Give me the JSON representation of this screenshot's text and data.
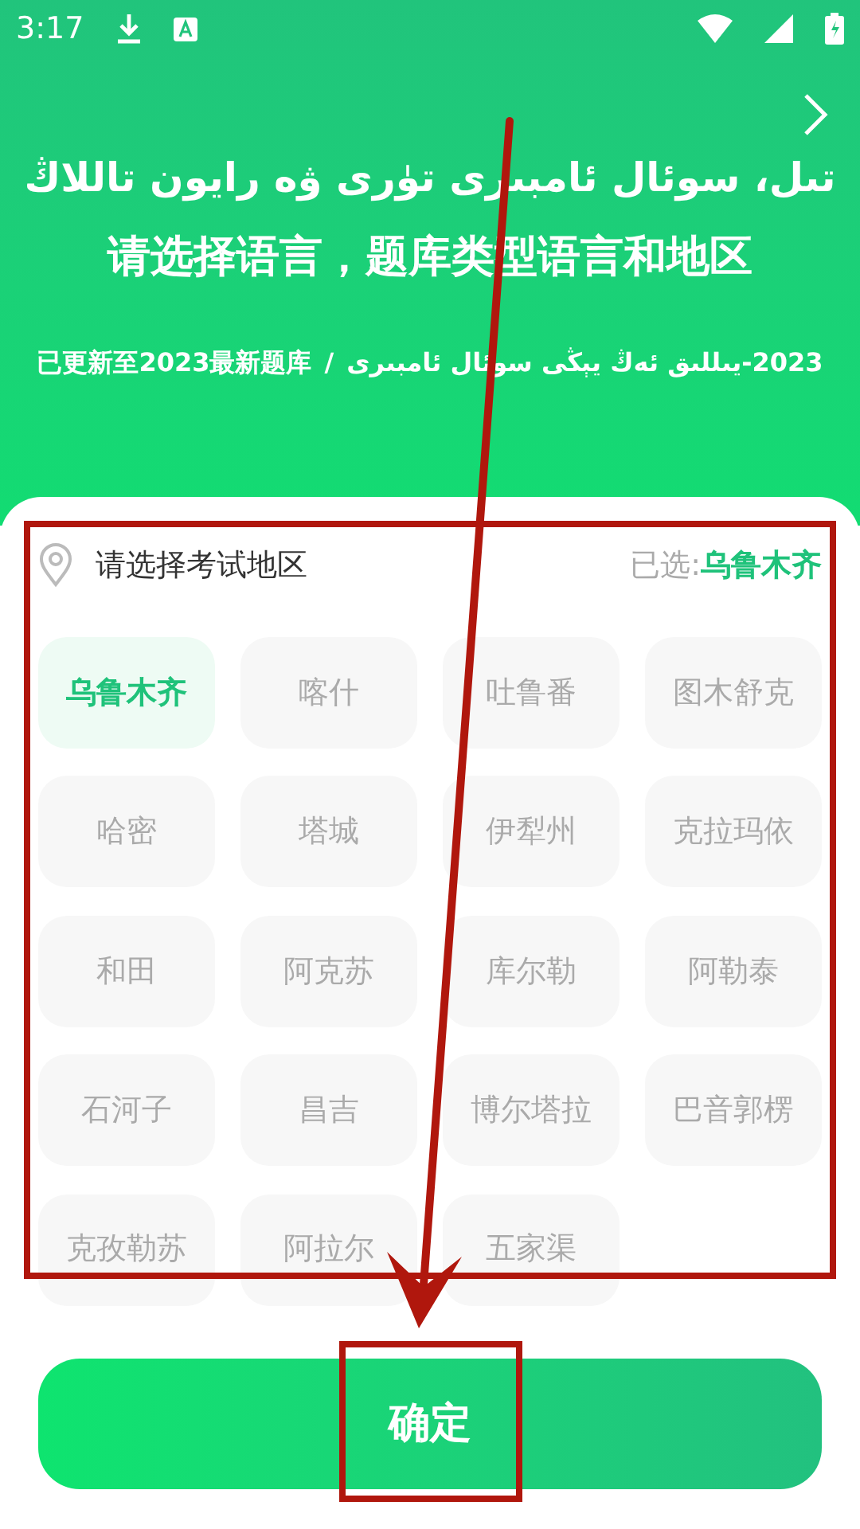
{
  "status_bar": {
    "time": "3:17"
  },
  "header": {
    "title_ug": "تىل، سوئال ئامبىرى تۈرى ۋە رايون تاللاڭ",
    "title_zh": "请选择语言，题库类型语言和地区",
    "subtitle_zh": "已更新至2023最新题库",
    "separator": "/",
    "subtitle_ug": "2023-يىللىق ئەڭ يېڭى سوئال ئامبىرى"
  },
  "region_panel": {
    "title": "请选择考试地区",
    "selected_label": "已选:",
    "selected_value": "乌鲁木齐",
    "regions": [
      {
        "label": "乌鲁木齐",
        "selected": true
      },
      {
        "label": "喀什",
        "selected": false
      },
      {
        "label": "吐鲁番",
        "selected": false
      },
      {
        "label": "图木舒克",
        "selected": false
      },
      {
        "label": "哈密",
        "selected": false
      },
      {
        "label": "塔城",
        "selected": false
      },
      {
        "label": "伊犁州",
        "selected": false
      },
      {
        "label": "克拉玛依",
        "selected": false
      },
      {
        "label": "和田",
        "selected": false
      },
      {
        "label": "阿克苏",
        "selected": false
      },
      {
        "label": "库尔勒",
        "selected": false
      },
      {
        "label": "阿勒泰",
        "selected": false
      },
      {
        "label": "石河子",
        "selected": false
      },
      {
        "label": "昌吉",
        "selected": false
      },
      {
        "label": "博尔塔拉",
        "selected": false
      },
      {
        "label": "巴音郭楞",
        "selected": false
      },
      {
        "label": "克孜勒苏",
        "selected": false
      },
      {
        "label": "阿拉尔",
        "selected": false
      },
      {
        "label": "五家渠",
        "selected": false
      }
    ]
  },
  "confirm_button": {
    "label": "确定"
  }
}
